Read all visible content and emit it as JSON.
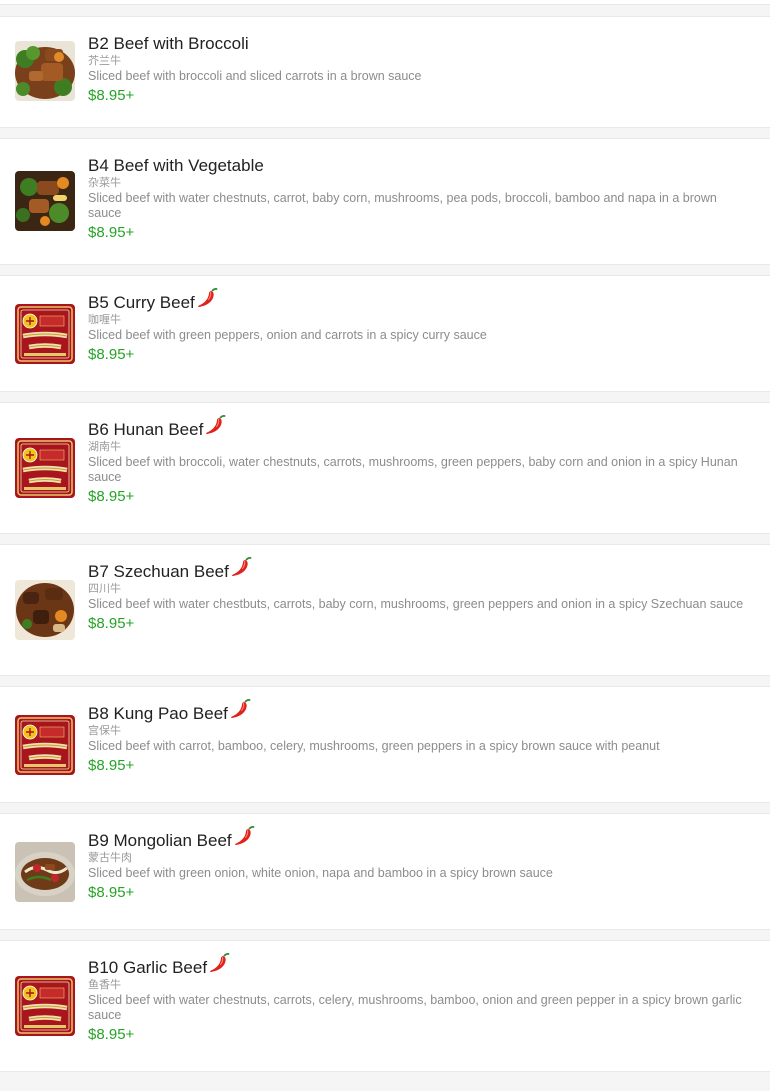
{
  "icons": {
    "spicy": "chili-pepper-icon"
  },
  "colors": {
    "price": "#27a327",
    "name": "#222222",
    "description": "#8c8c8c",
    "background": "#f5f5f5",
    "card": "#ffffff",
    "chili": "#e0221b",
    "placeholder_badge": "#a8151c"
  },
  "items": [
    {
      "name": "B2 Beef with Broccoli",
      "chinese_name": "芥兰牛",
      "description": "Sliced beef with broccoli and sliced carrots in a brown sauce",
      "price": "$8.95+",
      "spicy": false,
      "image": "beef-broccoli-photo"
    },
    {
      "name": "B4 Beef with Vegetable",
      "chinese_name": "杂菜牛",
      "description": "Sliced beef with water chestnuts, carrot, baby corn, mushrooms, pea pods, broccoli, bamboo and napa in a brown sauce",
      "price": "$8.95+",
      "spicy": false,
      "image": "beef-vegetable-photo"
    },
    {
      "name": "B5 Curry Beef",
      "chinese_name": "咖喱牛",
      "description": "Sliced beef with green peppers, onion and carrots in a spicy curry sauce",
      "price": "$8.95+",
      "spicy": true,
      "image": "golden-wok-logo"
    },
    {
      "name": "B6 Hunan Beef",
      "chinese_name": "湖南牛",
      "description": "Sliced beef with broccoli, water chestnuts, carrots, mushrooms, green peppers, baby corn and onion in a spicy Hunan sauce",
      "price": "$8.95+",
      "spicy": true,
      "image": "golden-wok-logo"
    },
    {
      "name": "B7 Szechuan Beef",
      "chinese_name": "四川牛",
      "description": "Sliced beef with water chestbuts, carrots, baby corn, mushrooms, green peppers and onion in a spicy Szechuan sauce",
      "price": "$8.95+",
      "spicy": true,
      "image": "szechuan-beef-photo"
    },
    {
      "name": "B8 Kung Pao Beef",
      "chinese_name": "宫保牛",
      "description": "Sliced beef with carrot, bamboo, celery, mushrooms, green peppers in a spicy brown sauce with peanut",
      "price": "$8.95+",
      "spicy": true,
      "image": "golden-wok-logo"
    },
    {
      "name": "B9 Mongolian Beef",
      "chinese_name": "蒙古牛肉",
      "description": "Sliced beef with green onion, white onion, napa and bamboo in a spicy brown sauce",
      "price": "$8.95+",
      "spicy": true,
      "image": "mongolian-beef-photo"
    },
    {
      "name": "B10 Garlic Beef",
      "chinese_name": "鱼香牛",
      "description": "Sliced beef with water chestnuts, carrots, celery, mushrooms, bamboo, onion and green pepper in a spicy brown garlic sauce",
      "price": "$8.95+",
      "spicy": true,
      "image": "golden-wok-logo"
    }
  ]
}
